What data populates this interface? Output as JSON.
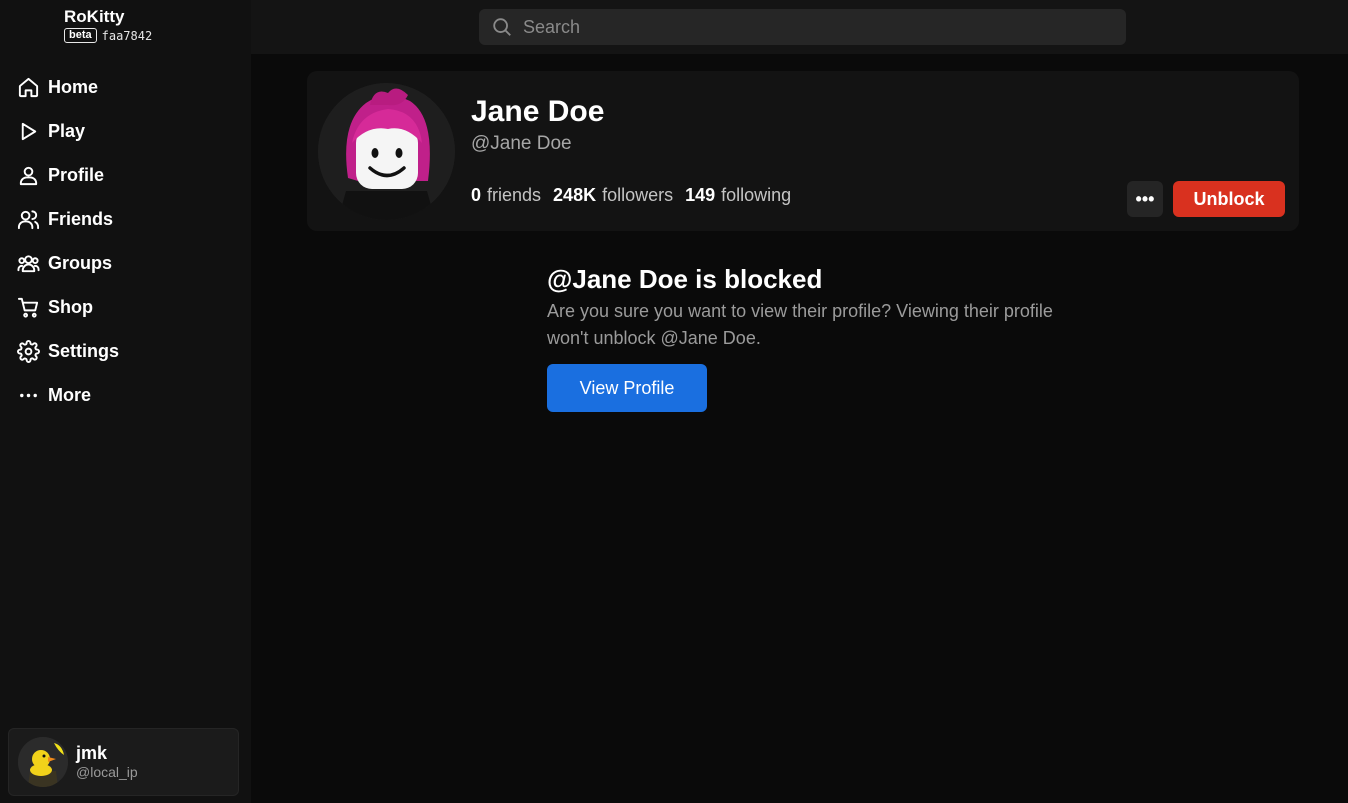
{
  "app": {
    "name": "RoKitty",
    "badge": "beta",
    "version": "faa7842"
  },
  "sidebar": {
    "items": [
      {
        "label": "Home",
        "icon": "home-icon"
      },
      {
        "label": "Play",
        "icon": "play-icon"
      },
      {
        "label": "Profile",
        "icon": "person-icon"
      },
      {
        "label": "Friends",
        "icon": "friends-icon"
      },
      {
        "label": "Groups",
        "icon": "groups-icon"
      },
      {
        "label": "Shop",
        "icon": "cart-icon"
      },
      {
        "label": "Settings",
        "icon": "gear-icon"
      },
      {
        "label": "More",
        "icon": "ellipsis-icon"
      }
    ]
  },
  "current_user": {
    "name": "jmk",
    "handle": "@local_ip"
  },
  "search": {
    "placeholder": "Search"
  },
  "profile": {
    "display_name": "Jane Doe",
    "handle": "@Jane Doe",
    "friends_count": "0",
    "friends_label": "friends",
    "followers_count": "248K",
    "followers_label": "followers",
    "following_count": "149",
    "following_label": "following",
    "more_label": "•••",
    "unblock_label": "Unblock"
  },
  "blocked_notice": {
    "title": "@Jane Doe is blocked",
    "description": "Are you sure you want to view their profile? Viewing their profile won't unblock @Jane Doe.",
    "button_label": "View Profile"
  },
  "colors": {
    "unblock": "#d9311f",
    "view_profile": "#1a6fe0",
    "background": "#0a0a0a",
    "sidebar": "#111111"
  }
}
